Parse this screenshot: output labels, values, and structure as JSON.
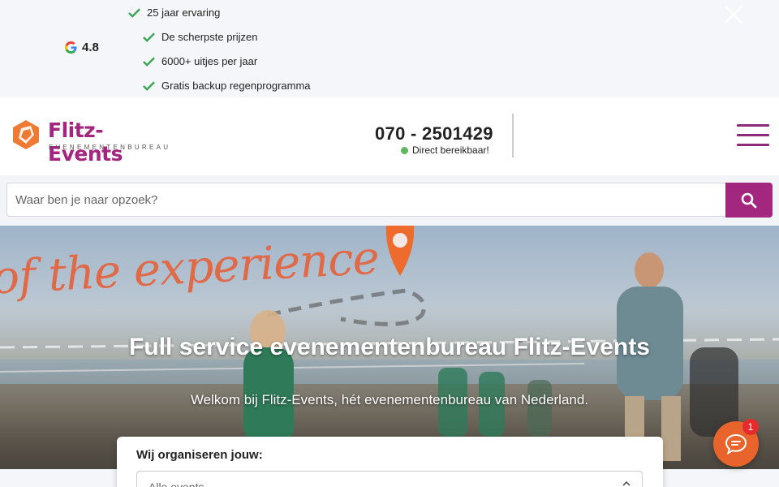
{
  "topbar": {
    "rating": "4.8",
    "usps": [
      "25 jaar ervaring",
      "De scherpste prijzen",
      "6000+ uitjes per jaar",
      "Gratis backup regenprogramma"
    ]
  },
  "header": {
    "logo_name": "Flitz-Events",
    "logo_sub": "EVENEMENTENBUREAU",
    "phone": "070 - 2501429",
    "reach": "Direct bereikbaar!"
  },
  "search": {
    "placeholder": "Waar ben je naar opzoek?"
  },
  "hero": {
    "title": "Full service evenementenbureau Flitz-Events",
    "subtitle": "Welkom bij Flitz-Events, hét evenementenbureau van Nederland.",
    "script_text": "of the experience"
  },
  "form": {
    "label": "Wij organiseren jouw:",
    "select_value": "Alle events"
  },
  "chat": {
    "badge": "1"
  },
  "colors": {
    "brand": "#a3267f",
    "accent": "#e8642c",
    "status": "#5cb85c"
  }
}
